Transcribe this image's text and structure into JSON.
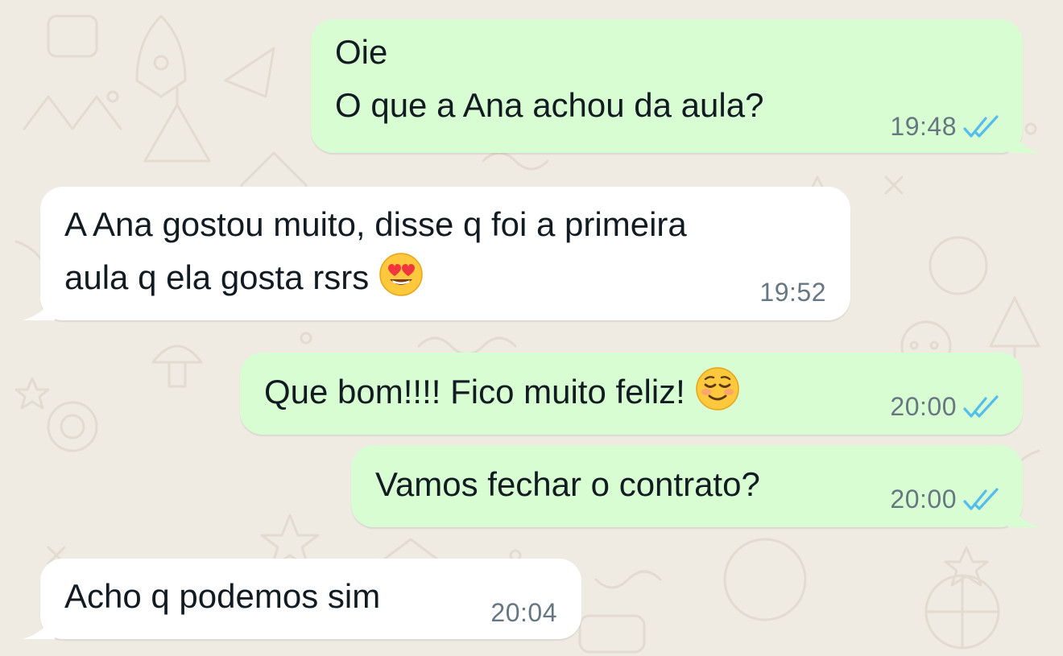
{
  "chat": {
    "messages": [
      {
        "id": "m1",
        "direction": "outgoing",
        "lines": [
          "Oie",
          "O que a Ana achou da aula?"
        ],
        "time": "19:48",
        "status": "read-double-check-icon"
      },
      {
        "id": "m2",
        "direction": "incoming",
        "lines": [
          "A Ana gostou muito, disse q foi a primeira",
          "aula q ela gosta rsrs"
        ],
        "emoji": "heart-eyes-emoji",
        "time": "19:52"
      },
      {
        "id": "m3",
        "direction": "outgoing",
        "lines": [
          "Que bom!!!! Fico muito feliz!"
        ],
        "emoji": "smiling-blush-emoji",
        "time": "20:00",
        "status": "read-double-check-icon"
      },
      {
        "id": "m4",
        "direction": "outgoing",
        "lines": [
          "Vamos fechar o contrato?"
        ],
        "time": "20:00",
        "status": "read-double-check-icon"
      },
      {
        "id": "m5",
        "direction": "incoming",
        "lines": [
          "Acho q podemos sim"
        ],
        "time": "20:04"
      }
    ]
  },
  "colors": {
    "background": "#efeae2",
    "outgoing_bubble": "#d9fdd3",
    "incoming_bubble": "#ffffff",
    "text": "#111b21",
    "meta": "#667781",
    "read_ticks": "#53bdeb"
  }
}
